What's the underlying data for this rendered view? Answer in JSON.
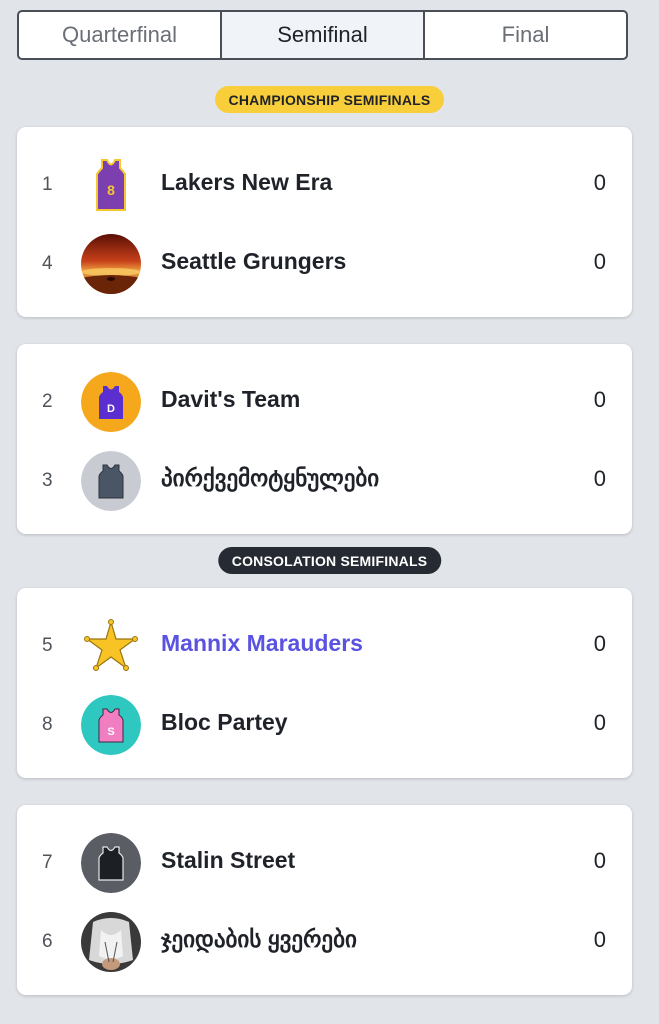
{
  "tabs": [
    {
      "label": "Quarterfinal",
      "active": false
    },
    {
      "label": "Semifinal",
      "active": true
    },
    {
      "label": "Final",
      "active": false
    }
  ],
  "sections": {
    "championship": "CHAMPIONSHIP SEMIFINALS",
    "consolation": "CONSOLATION SEMIFINALS"
  },
  "matchups": [
    {
      "teams": [
        {
          "seed": "1",
          "name": "Lakers New Era",
          "score": "0",
          "avatar": "purple-jersey-8-icon"
        },
        {
          "seed": "4",
          "name": "Seattle Grungers",
          "score": "0",
          "avatar": "sunset-photo-avatar"
        }
      ]
    },
    {
      "teams": [
        {
          "seed": "2",
          "name": "Davit's Team",
          "score": "0",
          "avatar": "jersey-d-icon"
        },
        {
          "seed": "3",
          "name": "პირქვემოტყნულები",
          "score": "0",
          "avatar": "gray-jersey-icon"
        }
      ]
    },
    {
      "teams": [
        {
          "seed": "5",
          "name": "Mannix Marauders",
          "score": "0",
          "avatar": "sheriff-star-icon"
        },
        {
          "seed": "8",
          "name": "Bloc Partey",
          "score": "0",
          "avatar": "jersey-s-icon"
        }
      ]
    },
    {
      "teams": [
        {
          "seed": "7",
          "name": "Stalin Street",
          "score": "0",
          "avatar": "black-jersey-icon"
        },
        {
          "seed": "6",
          "name": "ჯეიდაბის ყვერები",
          "score": "0",
          "avatar": "person-photo-avatar"
        }
      ]
    }
  ],
  "colors": {
    "background": "#e1e4e9",
    "gold_pill": "#f8cf3a",
    "dark_pill": "#262b33",
    "user_team_link": "#5a52e0"
  }
}
